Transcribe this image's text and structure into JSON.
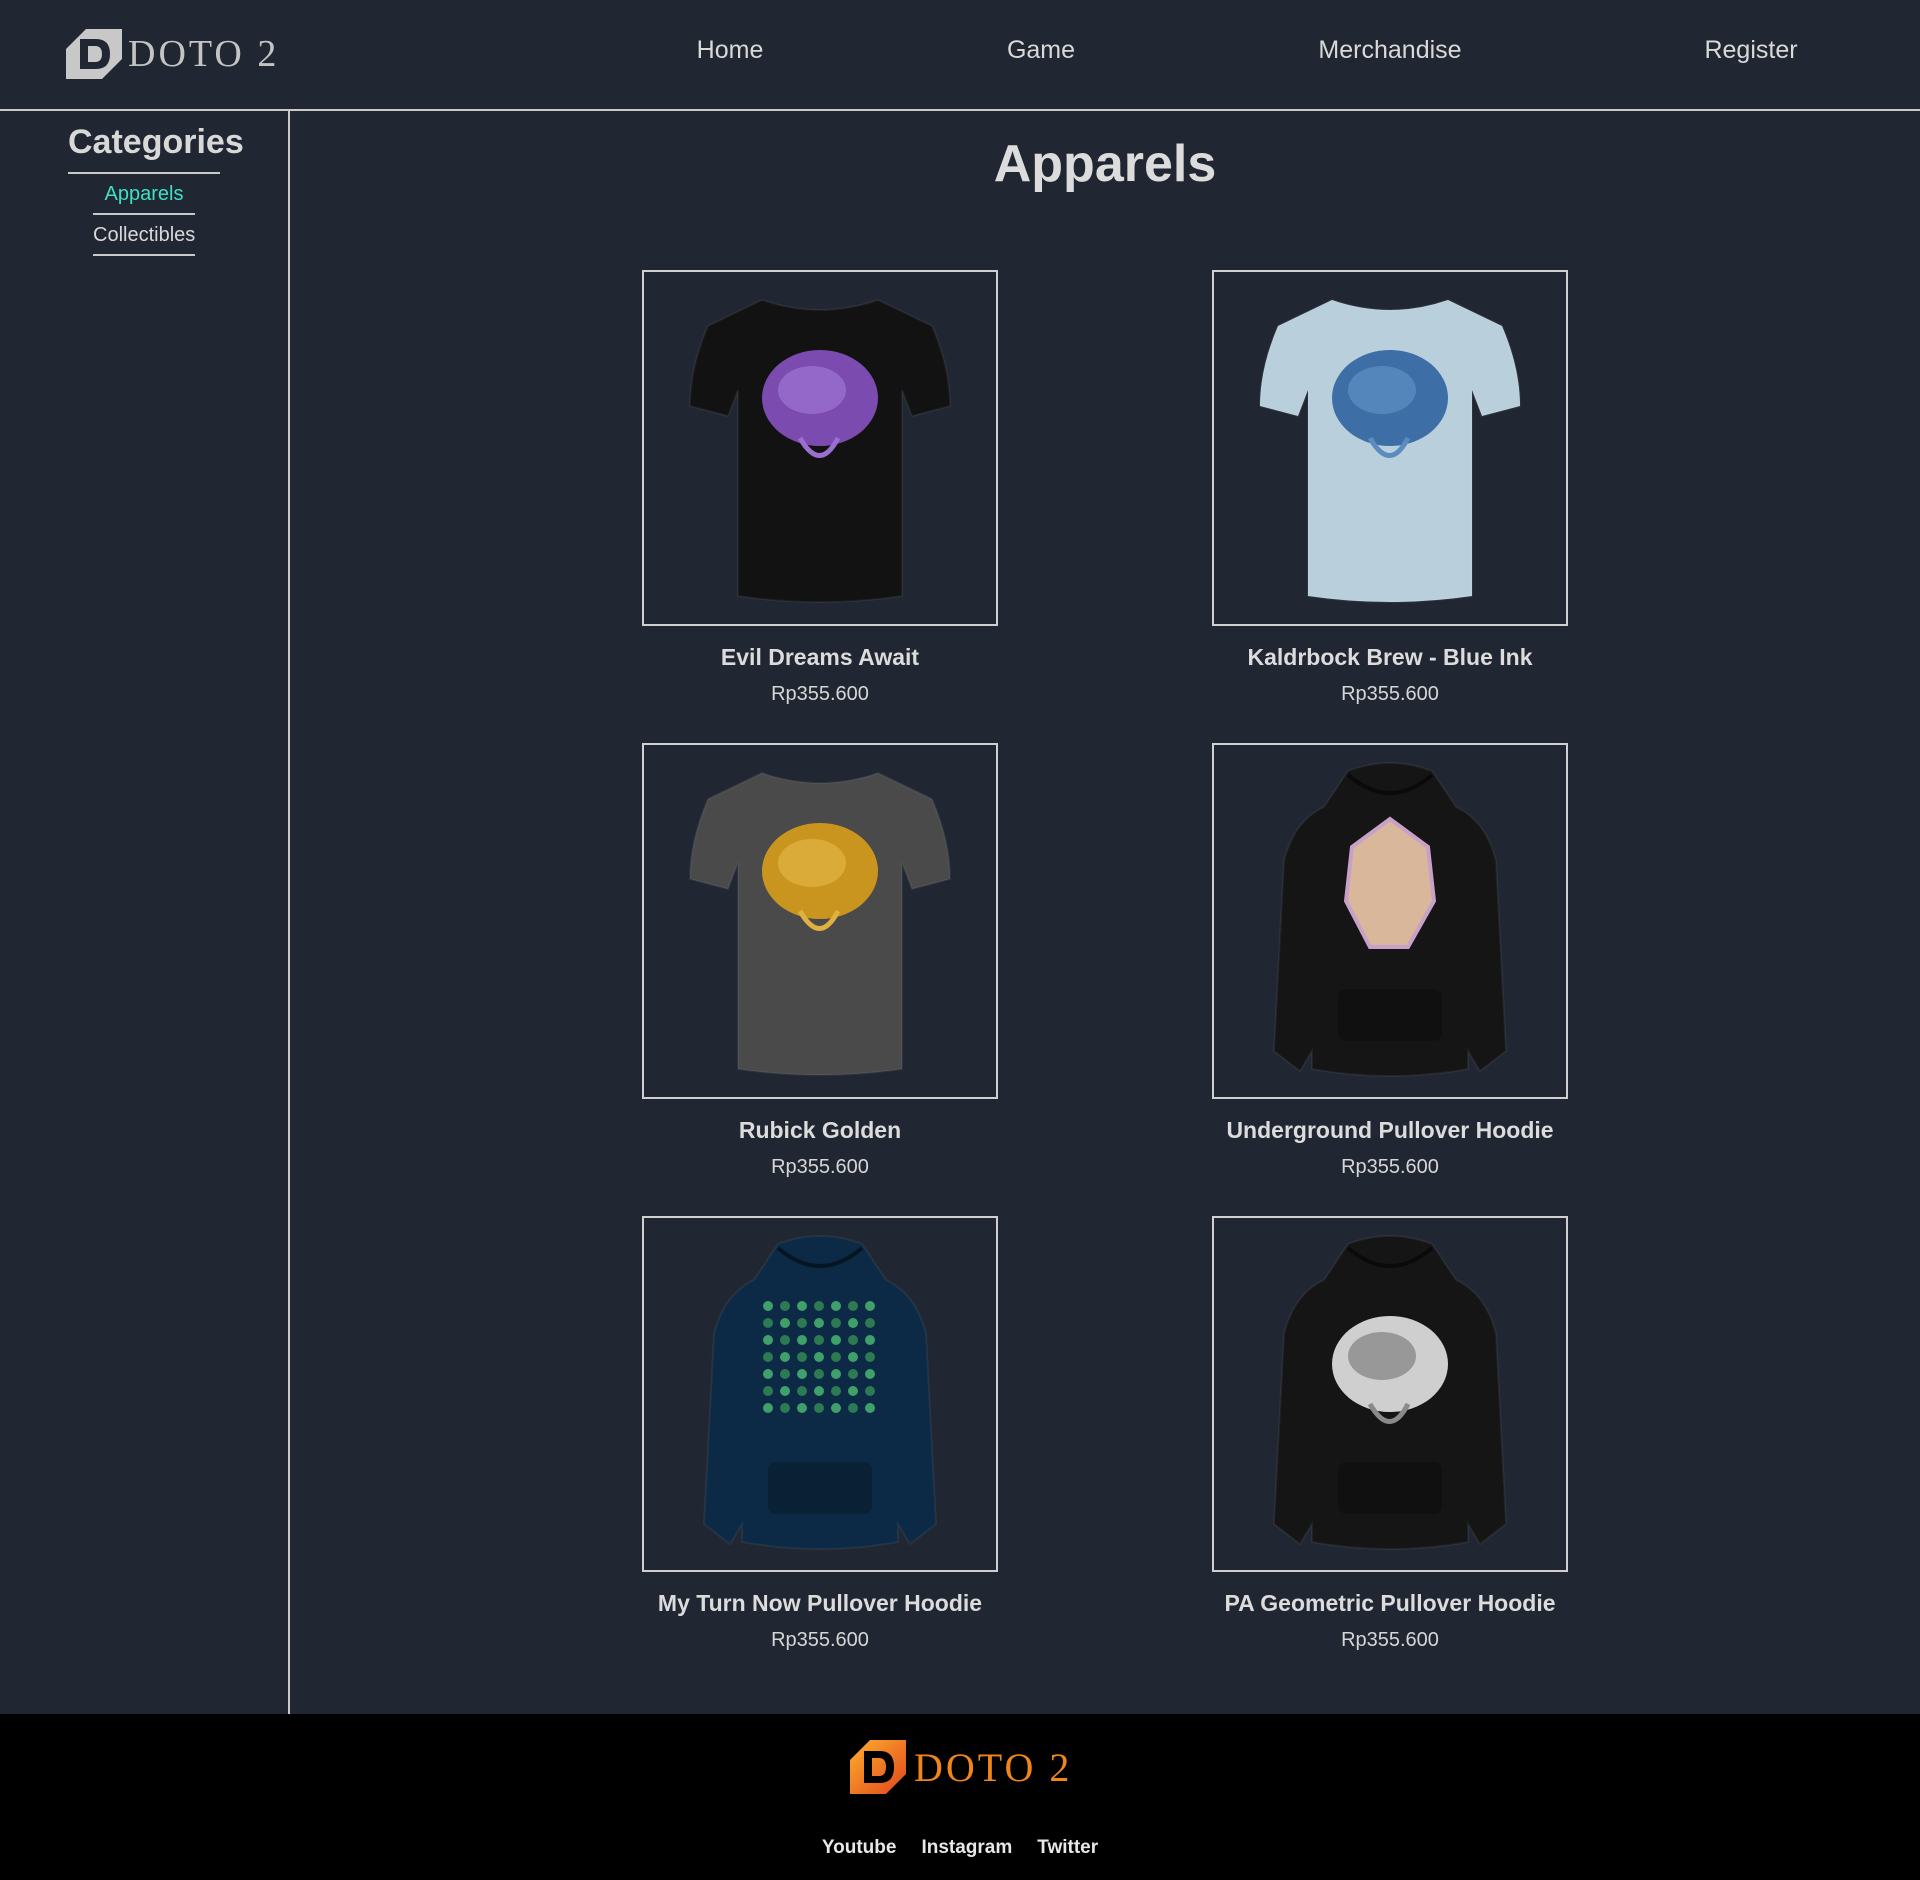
{
  "header": {
    "logo_text": "DOTO 2",
    "nav": [
      "Home",
      "Game",
      "Merchandise",
      "Register"
    ]
  },
  "sidebar": {
    "title": "Categories",
    "items": [
      {
        "label": "Apparels",
        "active": true
      },
      {
        "label": "Collectibles",
        "active": false
      }
    ]
  },
  "main": {
    "title": "Apparels",
    "products": [
      {
        "name": "Evil Dreams Await",
        "price": "Rp355.600",
        "garment": "tshirt",
        "color": "#121212",
        "print": "brain-purple"
      },
      {
        "name": "Kaldrbock Brew - Blue Ink",
        "price": "Rp355.600",
        "garment": "tshirt",
        "color": "#b9d0dc",
        "print": "crest-blue"
      },
      {
        "name": "Rubick Golden",
        "price": "Rp355.600",
        "garment": "tshirt",
        "color": "#4a4a4a",
        "print": "crest-gold"
      },
      {
        "name": "Underground Pullover Hoodie",
        "price": "Rp355.600",
        "garment": "hoodie",
        "color": "#151515",
        "print": "gem-pastel"
      },
      {
        "name": "My Turn Now Pullover Hoodie",
        "price": "Rp355.600",
        "garment": "hoodie",
        "color": "#0c2a45",
        "print": "pattern-green"
      },
      {
        "name": "PA Geometric Pullover Hoodie",
        "price": "Rp355.600",
        "garment": "hoodie",
        "color": "#151515",
        "print": "sketch-white"
      }
    ]
  },
  "footer": {
    "logo_text": "DOTO 2",
    "links": [
      "Youtube",
      "Instagram",
      "Twitter"
    ]
  }
}
